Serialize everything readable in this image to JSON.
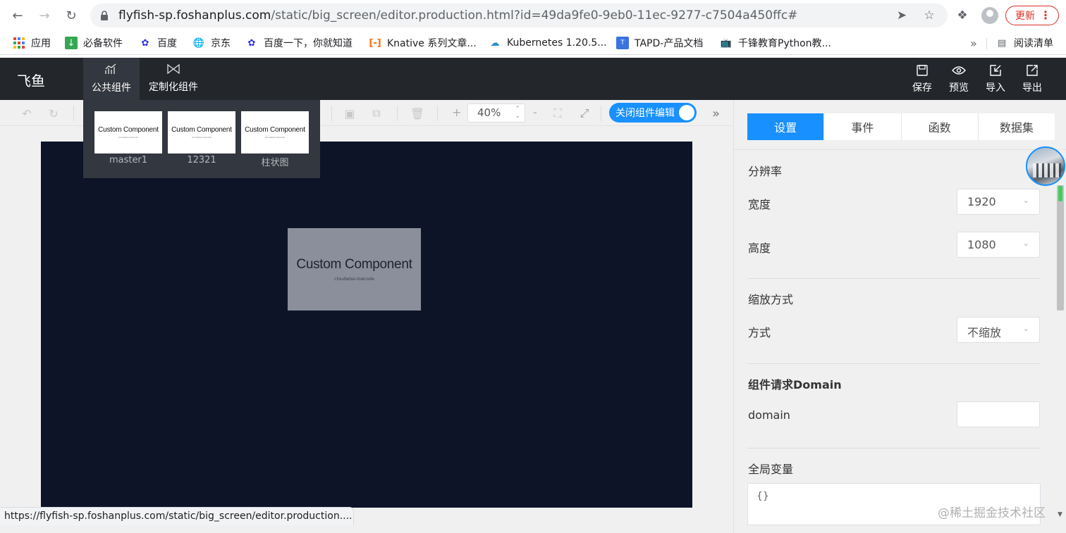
{
  "browser": {
    "url_host": "flyfish-sp.foshanplus.com",
    "url_path": "/static/big_screen/editor.production.html?id=49da9fe0-9eb0-11ec-9277-c7504a450ffc#",
    "update_label": "更新",
    "status_url": "https://flyfish-sp.foshanplus.com/static/big_screen/editor.production...."
  },
  "bookmarks": {
    "items": [
      {
        "label": "应用",
        "icon": "apps-grid-icon"
      },
      {
        "label": "必备软件",
        "icon": "download-icon"
      },
      {
        "label": "百度",
        "icon": "paw-icon"
      },
      {
        "label": "京东",
        "icon": "globe-icon"
      },
      {
        "label": "百度一下，你就知道",
        "icon": "paw-icon"
      },
      {
        "label": "Knative 系列文章...",
        "icon": "bracket-icon"
      },
      {
        "label": "Kubernetes 1.20.5...",
        "icon": "cloud-icon"
      },
      {
        "label": "TAPD-产品文档",
        "icon": "tapd-icon"
      },
      {
        "label": "千锋教育Python教...",
        "icon": "tv-icon"
      }
    ],
    "more": "»",
    "reading_list": "阅读清单"
  },
  "app": {
    "logo": "飞鱼",
    "tabs": [
      {
        "label": "公共组件",
        "icon": "chart-icon"
      },
      {
        "label": "定制化组件",
        "icon": "bowtie-icon"
      }
    ],
    "actions": [
      {
        "label": "保存",
        "icon": "save-icon"
      },
      {
        "label": "预览",
        "icon": "eye-icon"
      },
      {
        "label": "导入",
        "icon": "import-icon"
      },
      {
        "label": "导出",
        "icon": "export-icon"
      }
    ]
  },
  "toolbar": {
    "zoom": "40%",
    "zoom_plus": "+",
    "zoom_minus": "-",
    "toggle_label": "关闭组件编辑"
  },
  "components_panel": {
    "items": [
      {
        "thumb_title": "Custom Component",
        "label": "master1"
      },
      {
        "thumb_title": "Custom Component",
        "label": "12321"
      },
      {
        "thumb_title": "Custom Component",
        "label": "柱状图"
      }
    ]
  },
  "canvas": {
    "component_title": "Custom Component",
    "component_sub": "cloudwise-lowcode",
    "background": "#0d1428"
  },
  "side": {
    "tabs": [
      {
        "label": "设置",
        "active": true
      },
      {
        "label": "事件",
        "active": false
      },
      {
        "label": "函数",
        "active": false
      },
      {
        "label": "数据集",
        "active": false
      }
    ],
    "resolution_title": "分辨率",
    "width_label": "宽度",
    "width_value": "1920",
    "height_label": "高度",
    "height_value": "1080",
    "scale_title": "缩放方式",
    "mode_label": "方式",
    "mode_value": "不缩放",
    "domain_title": "组件请求Domain",
    "domain_label": "domain",
    "domain_value": "",
    "globals_title": "全局变量",
    "globals_value": "{}"
  },
  "watermark": "@稀土掘金技术社区",
  "colors": {
    "accent": "#1890ff",
    "header_bg": "#23262b",
    "update_red": "#d93025"
  }
}
